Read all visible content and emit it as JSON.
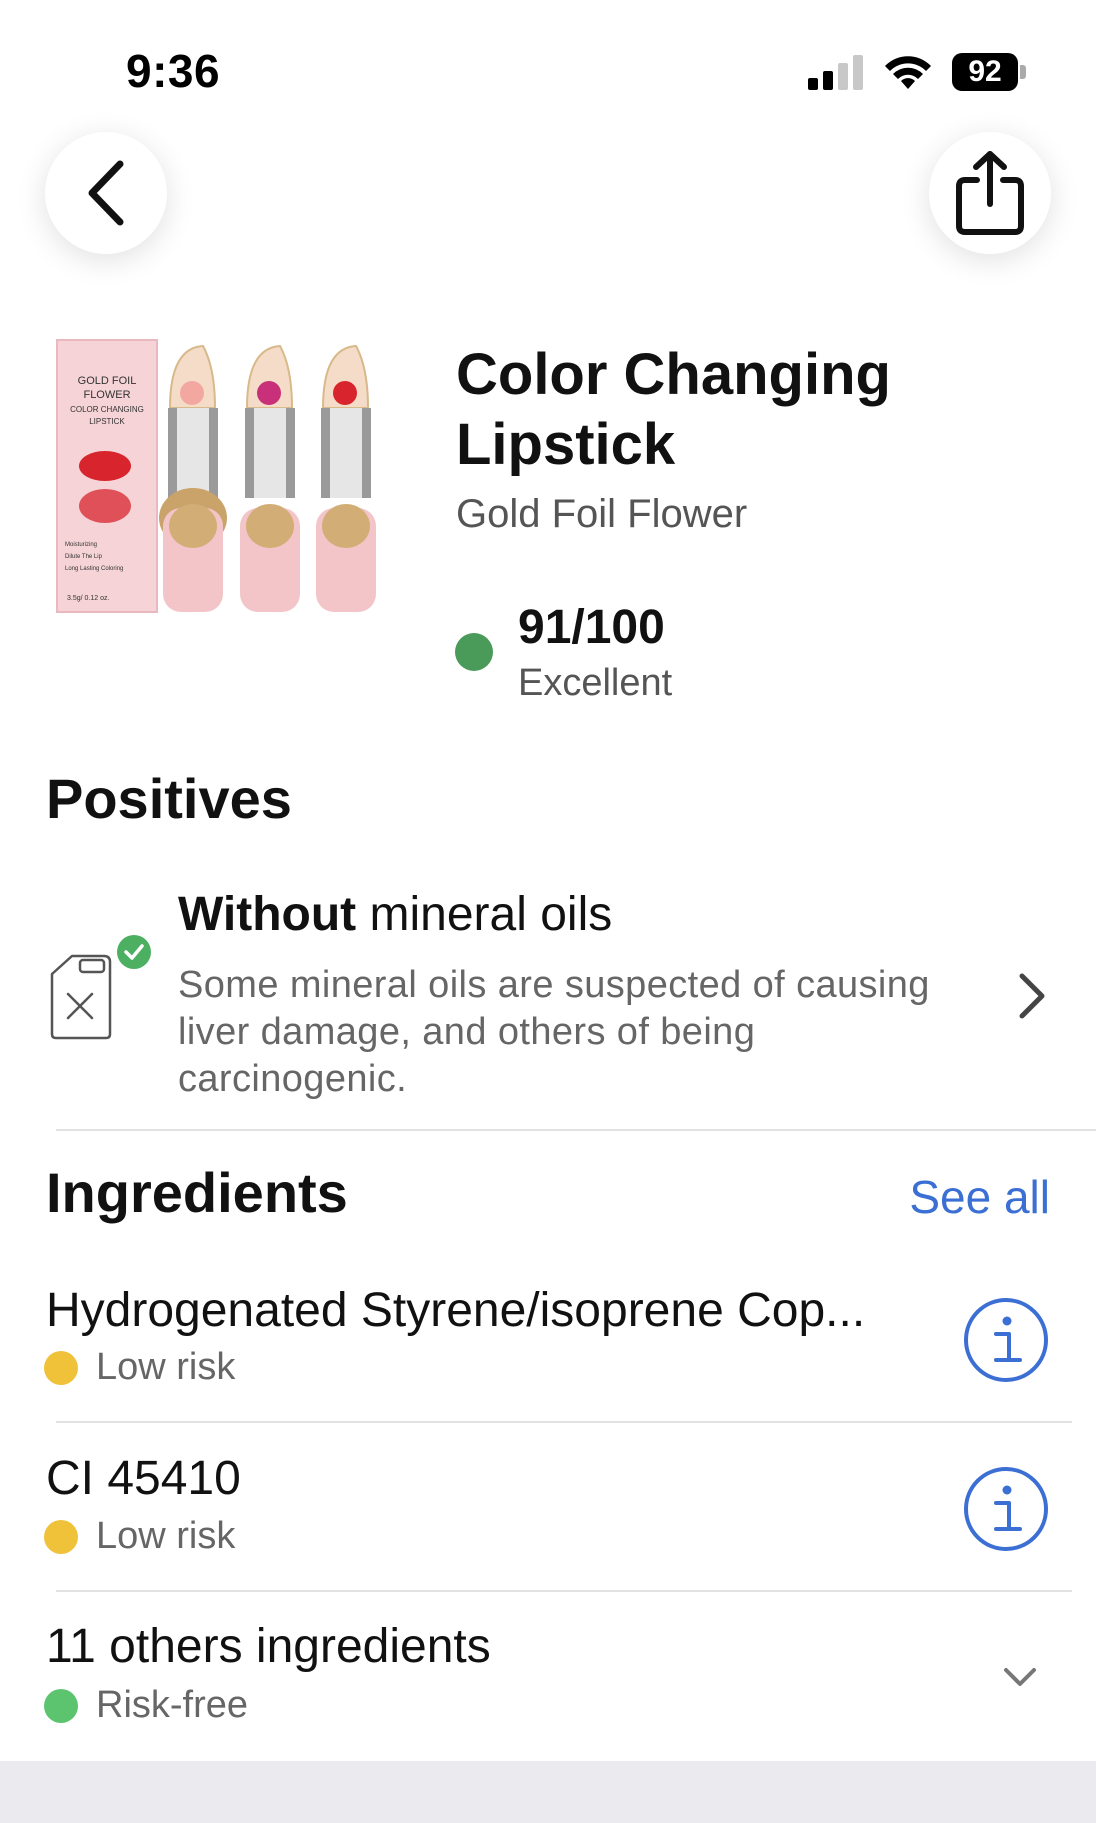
{
  "status_bar": {
    "time": "9:36",
    "battery": "92",
    "icons": [
      "signal-icon",
      "wifi-icon",
      "battery-icon"
    ]
  },
  "header": {
    "back_icon": "chevron-left-icon",
    "share_icon": "share-icon"
  },
  "product": {
    "title": "Color Changing Lipstick",
    "brand": "Gold Foil Flower",
    "score": "91/100",
    "score_label": "Excellent",
    "score_color": "#4a9a5a",
    "image_box_text": [
      "GOLD FOIL",
      "FLOWER",
      "COLOR CHANGING",
      "LIPSTICK"
    ],
    "image_box_small": [
      "Moisturizing",
      "Dilute The Lip",
      "Long Lasting Coloring",
      "3.5g/ 0.12 oz."
    ]
  },
  "positives": {
    "heading": "Positives",
    "items": [
      {
        "title_bold": "Without",
        "title_rest": " mineral oils",
        "description": "Some mineral oils are suspected of causing liver damage, and others of being carcinogenic.",
        "icon": "jerrycan-icon"
      }
    ]
  },
  "ingredients": {
    "heading": "Ingredients",
    "see_all": "See all",
    "items": [
      {
        "name": "Hydrogenated Styrene/isoprene Cop...",
        "risk": "Low risk",
        "risk_color": "#f0c23a"
      },
      {
        "name": "CI 45410",
        "risk": "Low risk",
        "risk_color": "#f0c23a"
      },
      {
        "name": "11 others ingredients",
        "risk": "Risk-free",
        "risk_color": "#5cc46e"
      }
    ]
  },
  "colors": {
    "accent": "#3b6fd4",
    "excellent": "#4a9a5a"
  }
}
